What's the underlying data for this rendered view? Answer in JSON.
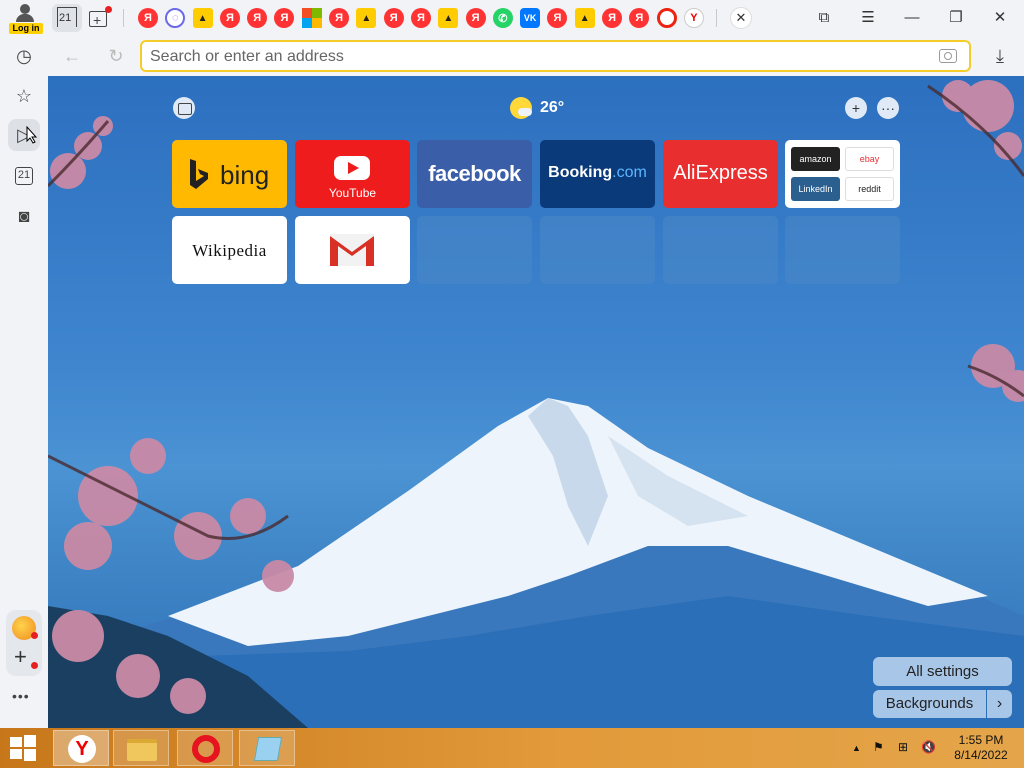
{
  "tabbar": {
    "login_label": "Log in",
    "home_tab_number": "21",
    "pinned_tabs": [
      {
        "icon": "yandex-icon",
        "glyph": "Я",
        "kind": "ya"
      },
      {
        "icon": "messenger-icon",
        "glyph": "◌",
        "kind": "msg"
      },
      {
        "icon": "images-icon",
        "glyph": "▲",
        "kind": "img"
      },
      {
        "icon": "yandex-icon",
        "glyph": "Я",
        "kind": "ya"
      },
      {
        "icon": "yandex-icon",
        "glyph": "Я",
        "kind": "ya"
      },
      {
        "icon": "yandex-icon",
        "glyph": "Я",
        "kind": "ya"
      },
      {
        "icon": "microsoft-icon",
        "glyph": "",
        "kind": "ms"
      },
      {
        "icon": "yandex-icon",
        "glyph": "Я",
        "kind": "ya"
      },
      {
        "icon": "images-icon",
        "glyph": "▲",
        "kind": "img"
      },
      {
        "icon": "yandex-icon",
        "glyph": "Я",
        "kind": "ya"
      },
      {
        "icon": "yandex-icon",
        "glyph": "Я",
        "kind": "ya"
      },
      {
        "icon": "images-icon",
        "glyph": "▲",
        "kind": "img"
      },
      {
        "icon": "yandex-icon",
        "glyph": "Я",
        "kind": "ya"
      },
      {
        "icon": "whatsapp-icon",
        "glyph": "✆",
        "kind": "wa"
      },
      {
        "icon": "vk-icon",
        "glyph": "VK",
        "kind": "vk"
      },
      {
        "icon": "yandex-icon",
        "glyph": "Я",
        "kind": "ya"
      },
      {
        "icon": "images-icon",
        "glyph": "▲",
        "kind": "img"
      },
      {
        "icon": "yandex-icon",
        "glyph": "Я",
        "kind": "ya"
      },
      {
        "icon": "yandex-icon",
        "glyph": "Я",
        "kind": "ya"
      },
      {
        "icon": "opera-icon",
        "glyph": "",
        "kind": "op"
      },
      {
        "icon": "yandex-browser-icon",
        "glyph": "Y",
        "kind": "yb"
      }
    ],
    "close_glyph": "✕",
    "window_buttons": {
      "bookmarks": "⧉",
      "menu": "☰",
      "minimize": "—",
      "restore": "❐",
      "close": "✕"
    }
  },
  "addressbar": {
    "back_glyph": "←",
    "reload_glyph": "↻",
    "placeholder": "Search or enter an address",
    "download_glyph": "⤓"
  },
  "sidebar": {
    "history_glyph": "◷",
    "bookmarks_glyph": "☆",
    "video_glyph": "▷",
    "calendar_number": "21",
    "screenshot_glyph": "◙",
    "add_glyph": "+",
    "more_glyph": "•••"
  },
  "ntp": {
    "weather_temp": "26°",
    "add_glyph": "+",
    "more_glyph": "···",
    "tiles": {
      "bing": "bing",
      "youtube": "YouTube",
      "facebook": "facebook",
      "booking_main": "Booking",
      "booking_suffix": ".com",
      "aliexpress": "AliExpress",
      "multi": [
        "amazon",
        "ebay",
        "LinkedIn",
        "reddit"
      ],
      "wikipedia": "Wikipedia"
    },
    "all_settings": "All settings",
    "backgrounds": "Backgrounds",
    "next_glyph": "›"
  },
  "taskbar": {
    "yandex_glyph": "Y",
    "tray": {
      "up": "▲",
      "flag": "⚑",
      "network": "⊞",
      "volume": "🔇"
    },
    "time": "1:55 PM",
    "date": "8/14/2022"
  },
  "colors": {
    "accent_yellow": "#f5cd2a",
    "sidebar_bg": "#f1f3f6",
    "taskbar": "#d98a2a"
  }
}
